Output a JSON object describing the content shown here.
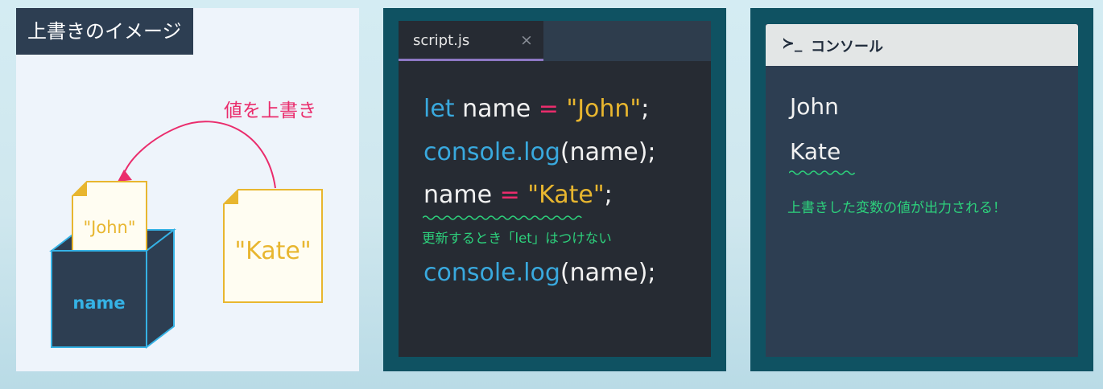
{
  "image_panel": {
    "title": "上書きのイメージ",
    "arrow_label": "値を上書き",
    "old_value": "\"John\"",
    "new_value": "\"Kate\"",
    "box_label": "name"
  },
  "editor": {
    "tab_label": "script.js",
    "tab_close": "×",
    "lines": [
      {
        "kw": "let",
        "ident": " name ",
        "op": "=",
        "str": " \"John\"",
        "end": ";"
      },
      {
        "fn": "console.log",
        "args": "(name);"
      },
      {
        "ident": "name",
        "op": " = ",
        "str": "\"Kate\"",
        "end": ";"
      },
      {
        "fn": "console.log",
        "args": "(name);"
      }
    ],
    "note": "更新するとき「let」はつけない"
  },
  "console": {
    "prompt": "≻_",
    "title": "コンソール",
    "outputs": [
      "John",
      "Kate"
    ],
    "note": "上書きした変数の値が出力される！"
  },
  "colors": {
    "navy": "#2d3e52",
    "teal": "#0f5262",
    "pink": "#ea2c6c",
    "yellow": "#e8b62f",
    "blue": "#39a9de",
    "green": "#2dd17c",
    "purple": "#8d78c4"
  }
}
